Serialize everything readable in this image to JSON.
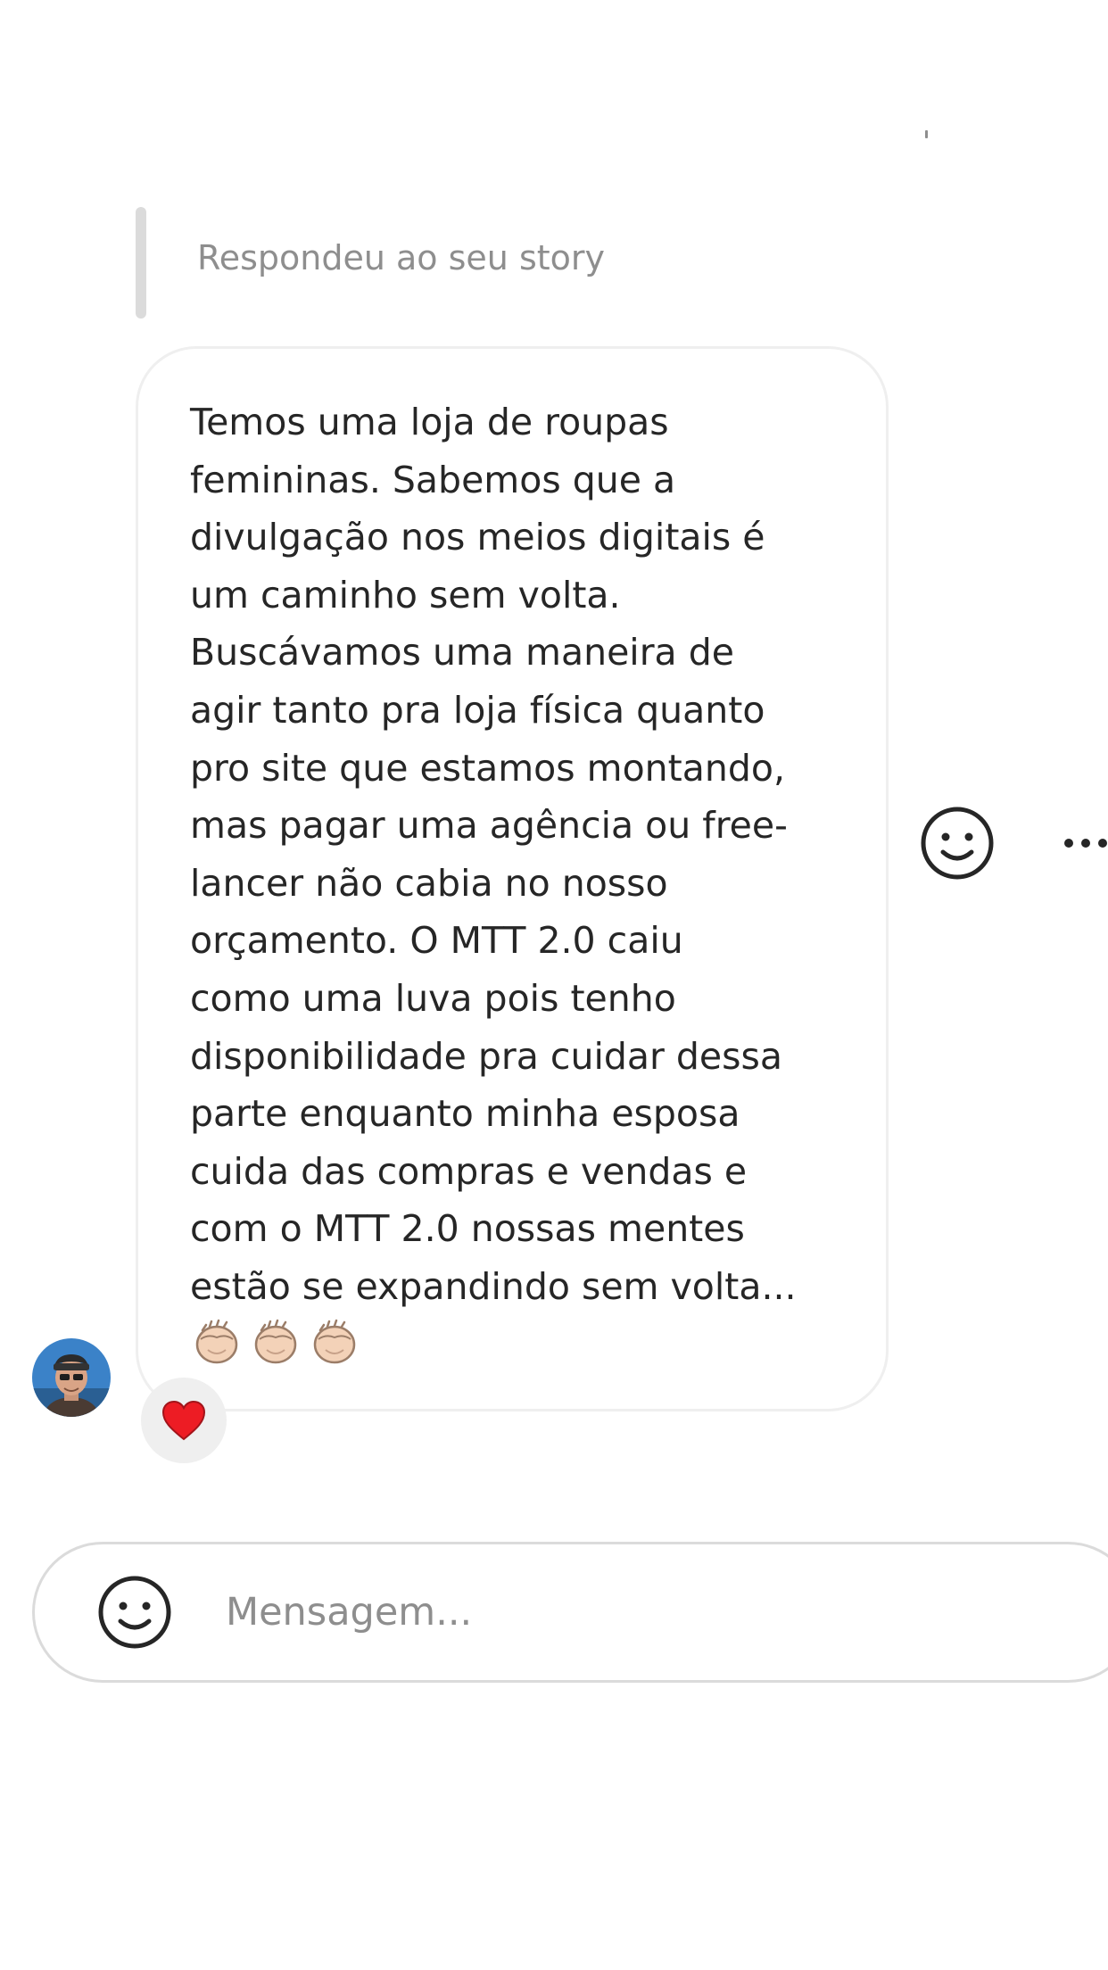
{
  "story_reply": {
    "label": "Respondeu ao seu story"
  },
  "message": {
    "text": "Temos uma loja de roupas\nfemininas. Sabemos que a\ndivulgação nos meios digitais é\num caminho sem volta.\nBuscávamos uma maneira de\nagir tanto pra loja física quanto\npro site que estamos montando,\nmas pagar uma agência ou free-\nlancer não cabia no nosso\norçamento. O MTT 2.0 caiu\ncomo uma luva pois tenho\ndisponibilidade pra cuidar dessa\nparte enquanto minha esposa\ncuida das compras e vendas e\ncom o MTT 2.0 nossas mentes\nestão se expandindo sem volta...",
    "emoji_icons": [
      "clapping-hands-icon",
      "clapping-hands-icon",
      "clapping-hands-icon"
    ],
    "reaction_icon": "red-heart-icon"
  },
  "actions": {
    "react_icon": "smiley-face-icon",
    "more_icon": "more-horizontal-icon"
  },
  "composer": {
    "placeholder": "Mensagem...",
    "emoji_icon": "smiley-face-icon"
  },
  "colors": {
    "text": "#262626",
    "muted": "#8e8e8e",
    "bubble_border": "#efefef",
    "reaction_bg": "#efefef",
    "heart": "#ed1c24"
  }
}
